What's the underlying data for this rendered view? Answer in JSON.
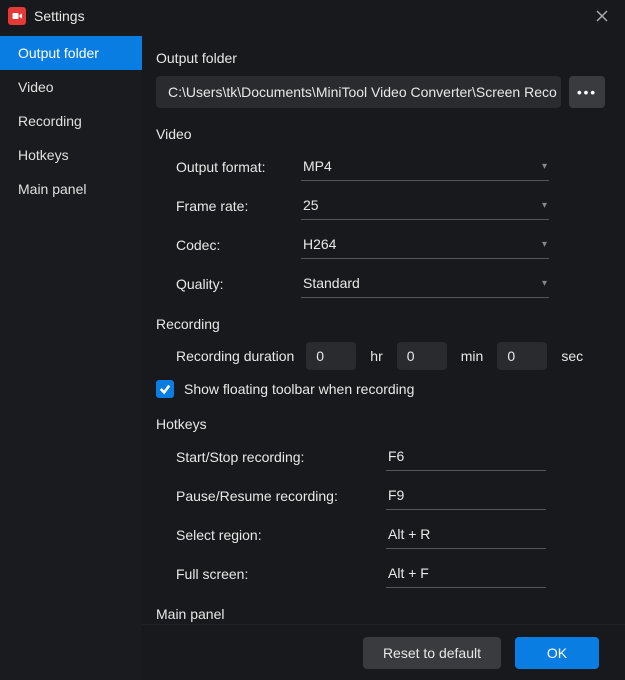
{
  "window": {
    "title": "Settings"
  },
  "sidebar": {
    "items": [
      {
        "label": "Output folder",
        "active": true
      },
      {
        "label": "Video",
        "active": false
      },
      {
        "label": "Recording",
        "active": false
      },
      {
        "label": "Hotkeys",
        "active": false
      },
      {
        "label": "Main panel",
        "active": false
      }
    ]
  },
  "sections": {
    "output_folder": {
      "heading": "Output folder",
      "path": "C:\\Users\\tk\\Documents\\MiniTool Video Converter\\Screen Reco"
    },
    "video": {
      "heading": "Video",
      "output_format": {
        "label": "Output format:",
        "value": "MP4"
      },
      "frame_rate": {
        "label": "Frame rate:",
        "value": "25"
      },
      "codec": {
        "label": "Codec:",
        "value": "H264"
      },
      "quality": {
        "label": "Quality:",
        "value": "Standard"
      }
    },
    "recording": {
      "heading": "Recording",
      "duration_label": "Recording duration",
      "hr": "0",
      "hr_unit": "hr",
      "min": "0",
      "min_unit": "min",
      "sec": "0",
      "sec_unit": "sec",
      "show_toolbar_label": "Show floating toolbar when recording",
      "show_toolbar_checked": true
    },
    "hotkeys": {
      "heading": "Hotkeys",
      "start_stop": {
        "label": "Start/Stop recording:",
        "value": "F6"
      },
      "pause_resume": {
        "label": "Pause/Resume recording:",
        "value": "F9"
      },
      "select_region": {
        "label": "Select region:",
        "value": "Alt + R"
      },
      "full_screen": {
        "label": "Full screen:",
        "value": "Alt + F"
      }
    },
    "main_panel": {
      "heading": "Main panel"
    }
  },
  "footer": {
    "reset": "Reset to default",
    "ok": "OK"
  }
}
